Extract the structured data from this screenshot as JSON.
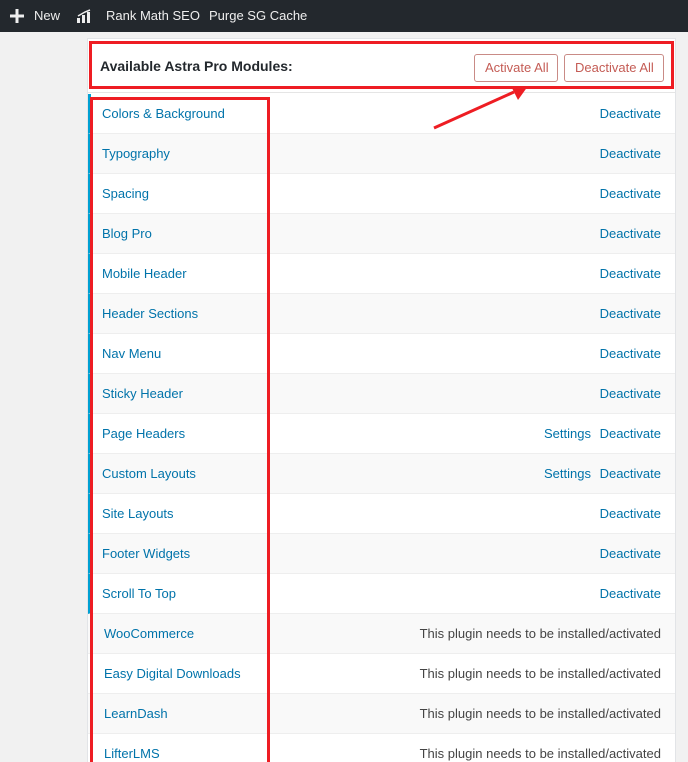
{
  "adminbar": {
    "new_label": "New",
    "rankmath_label": "Rank Math SEO",
    "purge_label": "Purge SG Cache"
  },
  "panel": {
    "title": "Available Astra Pro Modules:",
    "activate_all": "Activate All",
    "deactivate_all": "Deactivate All"
  },
  "modules": [
    {
      "name": "Colors & Background",
      "action": "Deactivate",
      "settings": ""
    },
    {
      "name": "Typography",
      "action": "Deactivate",
      "settings": ""
    },
    {
      "name": "Spacing",
      "action": "Deactivate",
      "settings": ""
    },
    {
      "name": "Blog Pro",
      "action": "Deactivate",
      "settings": ""
    },
    {
      "name": "Mobile Header",
      "action": "Deactivate",
      "settings": ""
    },
    {
      "name": "Header Sections",
      "action": "Deactivate",
      "settings": ""
    },
    {
      "name": "Nav Menu",
      "action": "Deactivate",
      "settings": ""
    },
    {
      "name": "Sticky Header",
      "action": "Deactivate",
      "settings": ""
    },
    {
      "name": "Page Headers",
      "action": "Deactivate",
      "settings": "Settings"
    },
    {
      "name": "Custom Layouts",
      "action": "Deactivate",
      "settings": "Settings"
    },
    {
      "name": "Site Layouts",
      "action": "Deactivate",
      "settings": ""
    },
    {
      "name": "Footer Widgets",
      "action": "Deactivate",
      "settings": ""
    },
    {
      "name": "Scroll To Top",
      "action": "Deactivate",
      "settings": ""
    }
  ],
  "plugin_modules": [
    {
      "name": "WooCommerce",
      "note": "This plugin needs to be installed/activated"
    },
    {
      "name": "Easy Digital Downloads",
      "note": "This plugin needs to be installed/activated"
    },
    {
      "name": "LearnDash",
      "note": "This plugin needs to be installed/activated"
    },
    {
      "name": "LifterLMS",
      "note": "This plugin needs to be installed/activated"
    }
  ],
  "colors": {
    "adminbar": "#23282d",
    "link": "#0073aa",
    "button_text": "#c45c55",
    "highlight": "#ee1d23",
    "active_border": "#00a0d2"
  },
  "icons": [
    "plus-icon",
    "rank-math-icon"
  ]
}
